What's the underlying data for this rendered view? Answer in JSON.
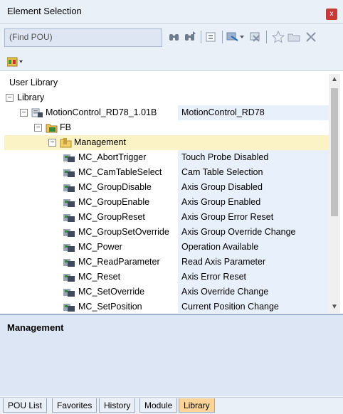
{
  "window": {
    "title": "Element Selection",
    "close_glyph": "x"
  },
  "search": {
    "placeholder": "(Find POU)"
  },
  "toolbar": {
    "icons": [
      "binoculars-find-icon",
      "binoculars-find-next-icon",
      "library-icon",
      "insert-icon",
      "delete-item-icon",
      "favorite-star-icon",
      "folder-icon",
      "close-x-icon"
    ]
  },
  "tree": {
    "rows": [
      {
        "name": "User Library",
        "desc": ""
      },
      {
        "name": "Library",
        "desc": ""
      },
      {
        "name": "MotionControl_RD78_1.01B",
        "desc": "MotionControl_RD78"
      },
      {
        "name": "FB",
        "desc": ""
      },
      {
        "name": "Management",
        "desc": ""
      },
      {
        "name": "MC_AbortTrigger",
        "desc": "Touch Probe Disabled"
      },
      {
        "name": "MC_CamTableSelect",
        "desc": "Cam Table Selection"
      },
      {
        "name": "MC_GroupDisable",
        "desc": "Axis Group Disabled"
      },
      {
        "name": "MC_GroupEnable",
        "desc": "Axis Group Enabled"
      },
      {
        "name": "MC_GroupReset",
        "desc": "Axis Group Error Reset"
      },
      {
        "name": "MC_GroupSetOverride",
        "desc": "Axis Group Override Change"
      },
      {
        "name": "MC_Power",
        "desc": "Operation Available"
      },
      {
        "name": "MC_ReadParameter",
        "desc": "Read Axis Parameter"
      },
      {
        "name": "MC_Reset",
        "desc": "Axis Error Reset"
      },
      {
        "name": "MC_SetOverride",
        "desc": "Axis Override Change"
      },
      {
        "name": "MC_SetPosition",
        "desc": "Current Position Change"
      }
    ]
  },
  "detail": {
    "title": "Management"
  },
  "tabs": [
    "POU List",
    "Favorites",
    "History",
    "Module",
    "Library"
  ],
  "colors": {
    "selected_row": "#fbf3c6",
    "active_tab": "#fbd49a",
    "detail_pane": "#dce6f4"
  }
}
